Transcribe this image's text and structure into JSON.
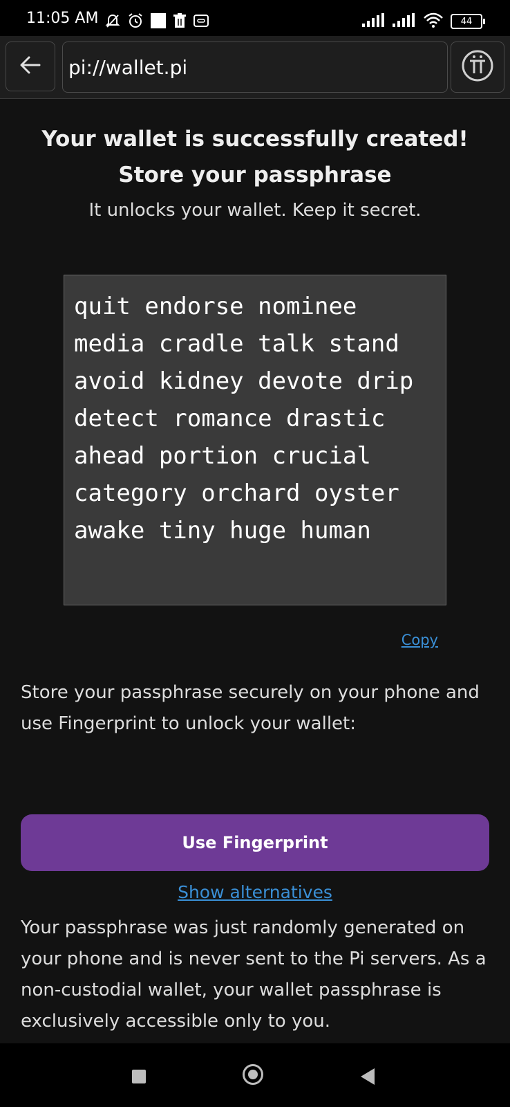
{
  "status_bar": {
    "time": "11:05 AM",
    "battery": "44",
    "icons": [
      "mute-icon",
      "alarm-icon",
      "square-icon",
      "trash-icon",
      "pass-icon",
      "signal-icon",
      "signal-icon",
      "wifi-icon",
      "battery-icon"
    ]
  },
  "browser": {
    "url": "pi://wallet.pi",
    "back_icon": "arrow-left-icon",
    "pi_icon": "pi-logo-icon"
  },
  "main": {
    "title_line1": "Your wallet is successfully created!",
    "title_line2": "Store your passphrase",
    "subtitle": "It unlocks your wallet. Keep it secret.",
    "passphrase": "quit endorse nominee media cradle talk stand avoid kidney devote drip detect romance drastic ahead portion crucial category orchard oyster awake tiny huge human",
    "copy_label": "Copy",
    "store_text": "Store your passphrase securely on your phone and use Fingerprint to unlock your wallet:",
    "fingerprint_button": "Use Fingerprint",
    "alternatives_link": "Show alternatives",
    "info_text": "Your passphrase was just randomly generated on your phone and is never sent to the Pi servers. As a non-custodial wallet, your wallet passphrase is exclusively accessible only to you."
  },
  "colors": {
    "background": "#121212",
    "accent_button": "#6e3a96",
    "link": "#3a8fd6"
  },
  "nav": {
    "icons": [
      "recents-icon",
      "home-icon",
      "back-icon"
    ]
  }
}
